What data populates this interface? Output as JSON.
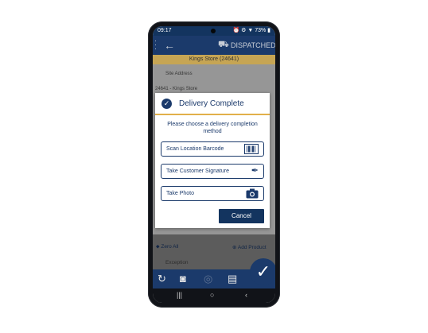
{
  "status_bar": {
    "time": "09:17",
    "indicators": "⏰ ⚙ ▼ 73% ▮"
  },
  "app_bar": {
    "title": "DISPATCHED",
    "back_icon": "←",
    "truck_icon": "truck-icon"
  },
  "store_banner": "Kings Store (24641)",
  "background": {
    "site_address_label": "Site Address",
    "site_address_value": "24641 - Kings Store",
    "zero_all_label": "Zero All",
    "add_product_label": "Add Product",
    "exception_label": "Exception"
  },
  "dialog": {
    "title": "Delivery Complete",
    "message": "Please choose a delivery completion method",
    "options": [
      {
        "label": "Scan Location Barcode",
        "icon": "barcode-icon"
      },
      {
        "label": "Take Customer Signature",
        "icon": "signature-pen-icon"
      },
      {
        "label": "Take Photo",
        "icon": "camera-icon"
      }
    ],
    "cancel_label": "Cancel"
  },
  "colors": {
    "primary": "#1b3a6b",
    "accent": "#e2b04a",
    "banner": "#c6a554"
  }
}
